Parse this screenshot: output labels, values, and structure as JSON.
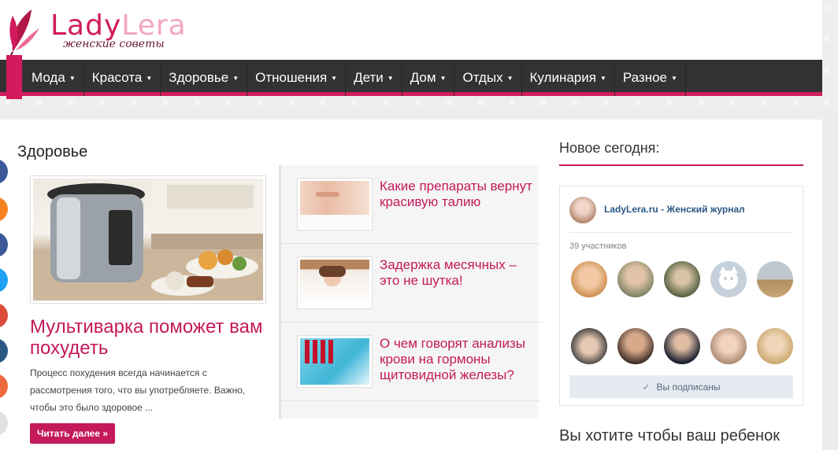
{
  "logo": {
    "brand_main": "Lady",
    "brand_accent": "Lera",
    "tagline": "женские советы"
  },
  "nav": {
    "items": [
      "Мода",
      "Красота",
      "Здоровье",
      "Отношения",
      "Дети",
      "Дом",
      "Отдых",
      "Кулинария",
      "Разное"
    ]
  },
  "section": {
    "title": "Здоровье"
  },
  "featured": {
    "image_icon": "multicooker-image",
    "title": "Мультиварка поможет вам похудеть",
    "excerpt": "Процесс похудения всегда начинается с рассмотрения того, что вы употребляете. Важно, чтобы это было здоровое ...",
    "read_more": "Читать далее »"
  },
  "articles": [
    {
      "title": "Какие препараты вернут красивую талию",
      "thumb": "waist-image"
    },
    {
      "title": "Задержка месячных – это не шутка!",
      "thumb": "woman-resting-image"
    },
    {
      "title": "О чем говорят анализы крови на гормоны щитовидной железы?",
      "thumb": "blood-test-image"
    }
  ],
  "sidebar": {
    "title": "Новое сегодня:",
    "widget": {
      "group_name": "LadyLera.ru - Женский журнал",
      "members": "39 участников",
      "subscribed": "Вы подписаны"
    },
    "question": "Вы хотите чтобы ваш ребенок учился на отлично?"
  },
  "colors": {
    "accent": "#c4195a",
    "nav_bg": "#323232",
    "link": "#2a5885"
  }
}
